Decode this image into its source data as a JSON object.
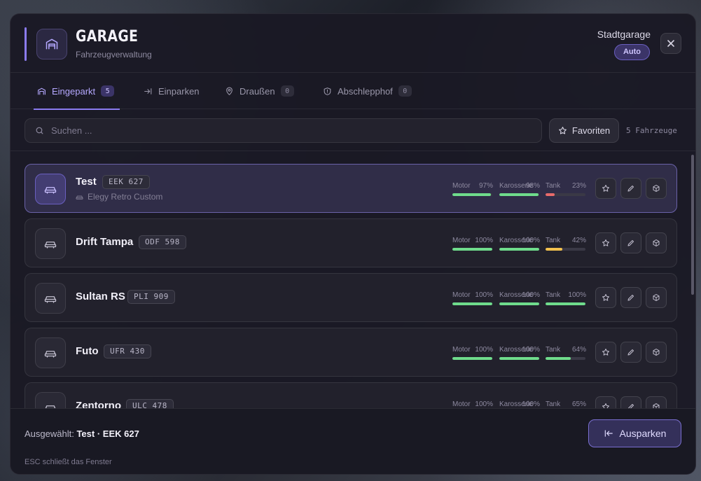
{
  "header": {
    "title": "GARAGE",
    "subtitle": "Fahrzeugverwaltung",
    "garage_name": "Stadtgarage",
    "type_badge": "Auto"
  },
  "tabs": [
    {
      "label": "Eingeparkt",
      "count": "5",
      "icon": "garage-icon",
      "active": true
    },
    {
      "label": "Einparken",
      "count": "",
      "icon": "park-in-icon",
      "active": false
    },
    {
      "label": "Draußen",
      "count": "0",
      "icon": "map-pin-icon",
      "active": false
    },
    {
      "label": "Abschlepphof",
      "count": "0",
      "icon": "shield-icon",
      "active": false
    }
  ],
  "search": {
    "placeholder": "Suchen ...",
    "value": "",
    "favorites_label": "Favoriten",
    "count_label": "5 Fahrzeuge"
  },
  "vehicles": [
    {
      "name": "Test",
      "plate": "EEK 627",
      "model": "Elegy Retro Custom",
      "selected": true,
      "motor": "97%",
      "body": "98%",
      "tank": "23%",
      "motor_v": 0.97,
      "body_v": 0.98,
      "tank_v": 0.23
    },
    {
      "name": "Drift Tampa",
      "plate": "ODF 598",
      "model": "",
      "selected": false,
      "motor": "100%",
      "body": "100%",
      "tank": "42%",
      "motor_v": 1.0,
      "body_v": 1.0,
      "tank_v": 0.42
    },
    {
      "name": "Sultan RS",
      "plate": "PLI 909",
      "model": "",
      "selected": false,
      "motor": "100%",
      "body": "100%",
      "tank": "100%",
      "motor_v": 1.0,
      "body_v": 1.0,
      "tank_v": 1.0
    },
    {
      "name": "Futo",
      "plate": "UFR 430",
      "model": "",
      "selected": false,
      "motor": "100%",
      "body": "100%",
      "tank": "64%",
      "motor_v": 1.0,
      "body_v": 1.0,
      "tank_v": 0.64
    },
    {
      "name": "Zentorno",
      "plate": "ULC 478",
      "model": "",
      "selected": false,
      "motor": "100%",
      "body": "100%",
      "tank": "65%",
      "motor_v": 1.0,
      "body_v": 1.0,
      "tank_v": 0.65
    }
  ],
  "stat_labels": {
    "motor": "Motor",
    "body": "Karosserie",
    "tank": "Tank"
  },
  "footer": {
    "selected_prefix": "Ausgewählt:",
    "selected_value": "Test · EEK 627",
    "hint": "ESC schließt das Fenster",
    "unpark_label": "Ausparken"
  },
  "colors": {
    "accent": "#8b7bf0",
    "good": "#6fdc8c",
    "warn": "#f2c14e",
    "bad": "#e86b6b"
  }
}
